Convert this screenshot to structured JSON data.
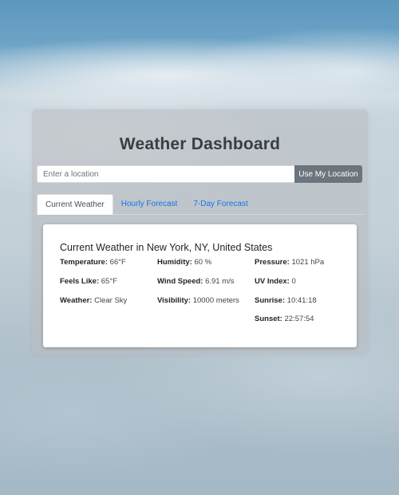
{
  "app": {
    "title": "Weather Dashboard"
  },
  "search": {
    "placeholder": "Enter a location",
    "value": "",
    "button_label": "Use My Location"
  },
  "tabs": [
    {
      "label": "Current Weather",
      "active": true
    },
    {
      "label": "Hourly Forecast",
      "active": false
    },
    {
      "label": "7-Day Forecast",
      "active": false
    }
  ],
  "current": {
    "heading": "Current Weather in New York, NY, United States",
    "stats": {
      "temperature": {
        "label": "Temperature:",
        "value": "66°F"
      },
      "feels_like": {
        "label": "Feels Like:",
        "value": "65°F"
      },
      "weather": {
        "label": "Weather:",
        "value": "Clear Sky"
      },
      "humidity": {
        "label": "Humidity:",
        "value": "60 %"
      },
      "wind_speed": {
        "label": "Wind Speed:",
        "value": "6.91 m/s"
      },
      "visibility": {
        "label": "Visibility:",
        "value": "10000 meters"
      },
      "pressure": {
        "label": "Pressure:",
        "value": "1021 hPa"
      },
      "uv_index": {
        "label": "UV Index:",
        "value": "0"
      },
      "sunrise": {
        "label": "Sunrise:",
        "value": "10:41:18"
      },
      "sunset": {
        "label": "Sunset:",
        "value": "22:57:54"
      }
    }
  },
  "colors": {
    "accent_link": "#1a73e8",
    "button_bg": "#6c757d",
    "title_text": "#3a3d42"
  }
}
